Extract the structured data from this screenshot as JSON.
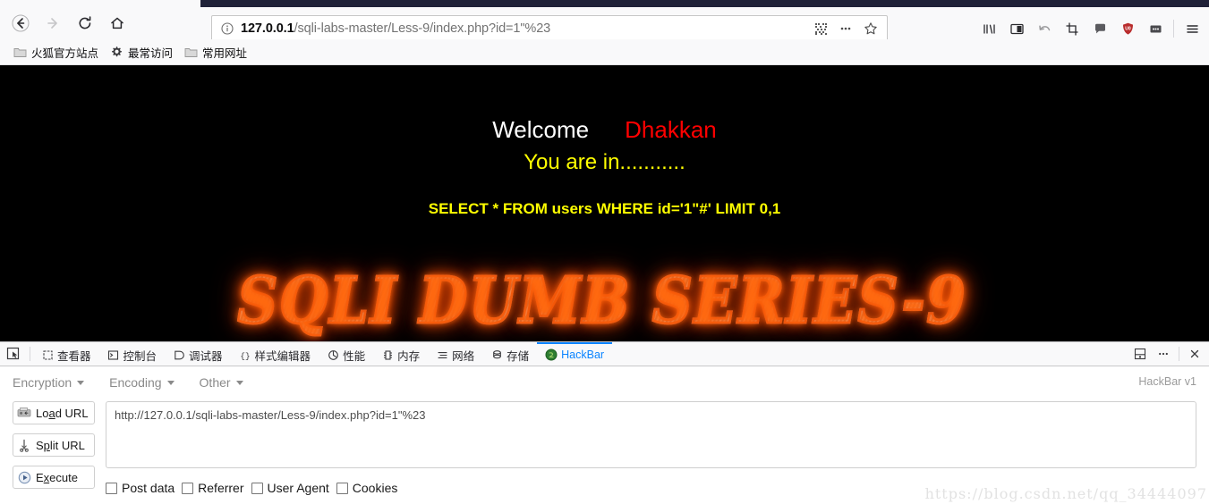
{
  "browser": {
    "nav": {
      "back_label": "Back",
      "forward_label": "Forward",
      "reload_label": "Reload",
      "home_label": "Home"
    },
    "urlbar": {
      "identity_icon": "info-circle-icon",
      "host": "127.0.0.1",
      "path": "/sqli-labs-master/Less-9/index.php?id=1\"%23",
      "full_url": "127.0.0.1/sqli-labs-master/Less-9/index.php?id=1\"%23",
      "qr_icon": "qrcode-icon",
      "page_actions_icon": "ellipsis-icon",
      "bookmark_icon": "star-icon"
    },
    "toolbar_icons": [
      "library-icon",
      "sidebar-icon",
      "undo-arrow-icon",
      "screenshot-crop-icon",
      "chat-bubble-icon",
      "ublock-shield-icon",
      "more-extensions-icon",
      "hamburger-menu-icon"
    ],
    "bookmarks": [
      {
        "label": "火狐官方站点",
        "icon": "folder-icon"
      },
      {
        "label": "最常访问",
        "icon": "gear-icon"
      },
      {
        "label": "常用网址",
        "icon": "folder-icon"
      }
    ]
  },
  "page": {
    "welcome_text": "Welcome",
    "user_name": "Dhakkan",
    "you_are_in": "You are in...........",
    "sql_query": "SELECT * FROM users WHERE id='1\"#' LIMIT 0,1",
    "banner_text": "SQLI DUMB SERIES-9",
    "colors": {
      "background": "#000000",
      "welcome": "#ffffff",
      "user_name": "#ff0000",
      "yellow": "#ffff00",
      "banner_outline": "#f26522"
    }
  },
  "devtools": {
    "picker_icon": "element-picker-icon",
    "tabs": [
      {
        "label": "查看器",
        "icon": "inspector-icon",
        "active": false
      },
      {
        "label": "控制台",
        "icon": "console-icon",
        "active": false
      },
      {
        "label": "调试器",
        "icon": "debugger-icon",
        "active": false
      },
      {
        "label": "样式编辑器",
        "icon": "style-editor-icon",
        "active": false
      },
      {
        "label": "性能",
        "icon": "performance-icon",
        "active": false
      },
      {
        "label": "内存",
        "icon": "memory-icon",
        "active": false
      },
      {
        "label": "网络",
        "icon": "network-icon",
        "active": false
      },
      {
        "label": "存储",
        "icon": "storage-icon",
        "active": false
      },
      {
        "label": "HackBar",
        "icon": "hackbar-icon",
        "active": true
      }
    ],
    "right_icons": [
      "dock-position-icon",
      "devtools-menu-icon",
      "close-icon"
    ],
    "active_tab_color": "#0a84ff"
  },
  "hackbar": {
    "menus": [
      {
        "label": "Encryption"
      },
      {
        "label": "Encoding"
      },
      {
        "label": "Other"
      }
    ],
    "version_label": "HackBar v1",
    "buttons": [
      {
        "label_pre": "Lo",
        "label_key": "a",
        "label_post": "d URL",
        "icon": "load-url-icon",
        "name": "load-url-button"
      },
      {
        "label_pre": "S",
        "label_key": "p",
        "label_post": "lit URL",
        "icon": "scissors-icon",
        "name": "split-url-button"
      },
      {
        "label_pre": "E",
        "label_key": "x",
        "label_post": "ecute",
        "icon": "play-icon",
        "name": "execute-button"
      }
    ],
    "url_value": "http://127.0.0.1/sqli-labs-master/Less-9/index.php?id=1\"%23",
    "url_placeholder": "",
    "checkboxes": [
      {
        "label": "Post data",
        "checked": false
      },
      {
        "label": "Referrer",
        "checked": false
      },
      {
        "label": "User Agent",
        "checked": false
      },
      {
        "label": "Cookies",
        "checked": false
      }
    ]
  },
  "watermark": "https://blog.csdn.net/qq_34444097"
}
